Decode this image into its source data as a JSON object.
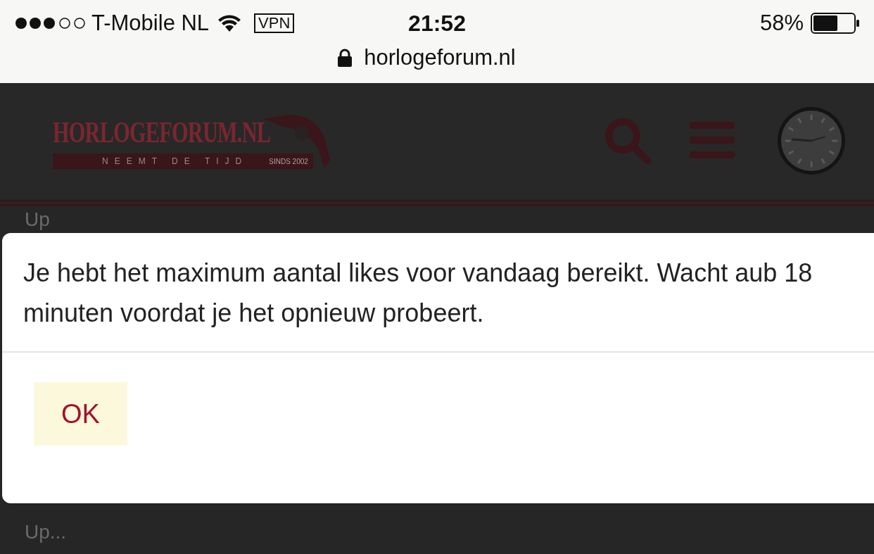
{
  "status_bar": {
    "carrier": "T-Mobile NL",
    "vpn": "VPN",
    "time": "21:52",
    "battery": "58%"
  },
  "address_bar": {
    "url": "horlogeforum.nl"
  },
  "header": {
    "logo": {
      "title": "HORLOGEFORUM.NL",
      "tagline": "NEEMT DE TIJD",
      "since": "SINDS 2002"
    }
  },
  "content": [
    {
      "text": "Up"
    },
    {
      "text": "Up..."
    }
  ],
  "dialog": {
    "message": "Je hebt het maximum aantal likes voor vandaag bereikt. Wacht aub 18 minuten voordat je het opnieuw probeert.",
    "buttons": [
      "OK"
    ]
  }
}
